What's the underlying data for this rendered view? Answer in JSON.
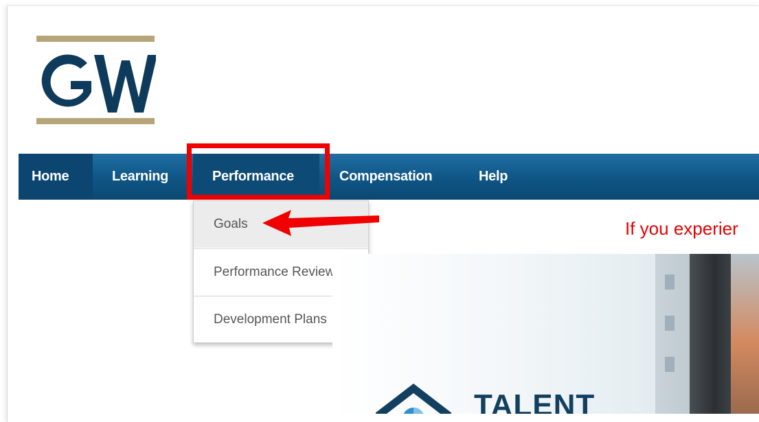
{
  "logo": {
    "text": "GW",
    "colors": {
      "letters": "#0e3a5b",
      "bars": "#b7a57a"
    }
  },
  "nav": {
    "items": [
      {
        "label": "Home"
      },
      {
        "label": "Learning"
      },
      {
        "label": "Performance"
      },
      {
        "label": "Compensation"
      },
      {
        "label": "Help"
      }
    ],
    "active": "Performance",
    "colors": {
      "bar": "#0f5585",
      "active": "#0d4a76",
      "text": "#ffffff"
    }
  },
  "dropdown": {
    "items": [
      {
        "label": "Goals"
      },
      {
        "label": "Performance Reviews"
      },
      {
        "label": "Development Plans"
      }
    ],
    "hovered": "Goals"
  },
  "notice": {
    "text": "If you experier",
    "color": "#e60000"
  },
  "hero": {
    "title": "TALENT"
  },
  "annotations": {
    "highlight_color": "#f00000",
    "arrow_color": "#f00000"
  }
}
